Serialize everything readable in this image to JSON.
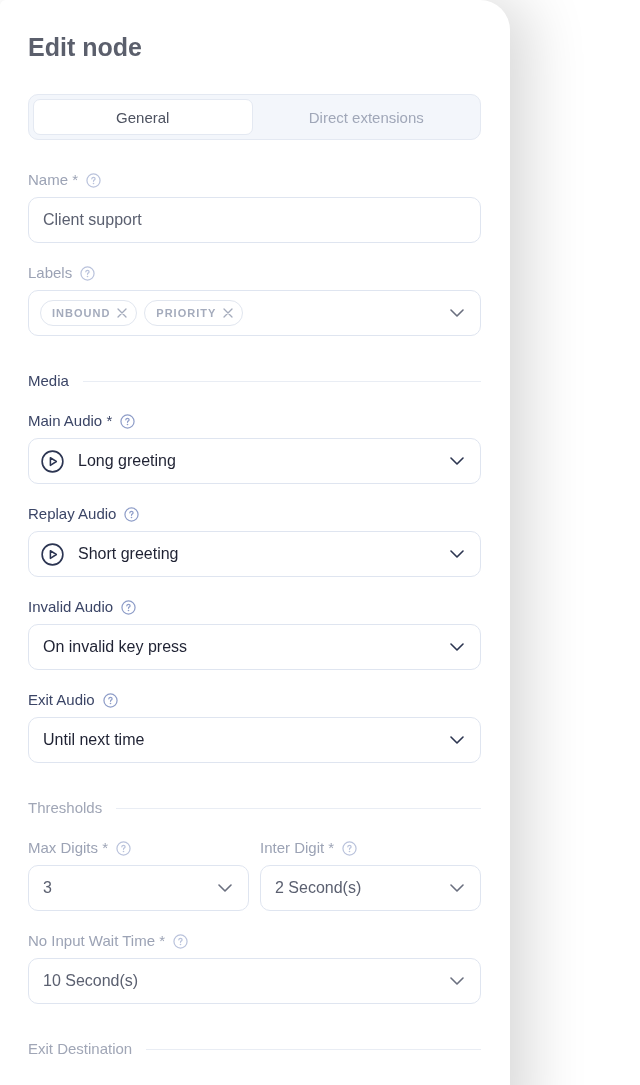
{
  "panel": {
    "title": "Edit node"
  },
  "tabs": [
    {
      "label": "General",
      "selected": true
    },
    {
      "label": "Direct extensions",
      "selected": false
    }
  ],
  "form": [
    {
      "kind": "text",
      "label": "Name *",
      "value": "Client support",
      "dimmed": true
    },
    {
      "kind": "tags",
      "label": "Labels",
      "tags": [
        "INBOUND",
        "PRIORITY"
      ],
      "dimmed": true
    },
    {
      "kind": "section",
      "title": "Media",
      "dimmed": false
    },
    {
      "kind": "audio_select",
      "label": "Main Audio *",
      "value": "Long greeting",
      "dimmed": false
    },
    {
      "kind": "audio_select",
      "label": "Replay Audio",
      "value": "Short greeting",
      "dimmed": false
    },
    {
      "kind": "select",
      "label": "Invalid Audio",
      "value": "On invalid key press",
      "dimmed": false
    },
    {
      "kind": "select",
      "label": "Exit Audio",
      "value": "Until next time",
      "dimmed": false
    },
    {
      "kind": "section",
      "title": "Thresholds",
      "dimmed": true
    },
    {
      "kind": "pair",
      "fields": [
        {
          "kind": "select",
          "label": "Max Digits *",
          "value": "3",
          "dimmed": true
        },
        {
          "kind": "select",
          "label": "Inter Digit *",
          "value": "2 Second(s)",
          "dimmed": true
        }
      ]
    },
    {
      "kind": "select",
      "label": "No Input Wait Time *",
      "value": "10 Second(s)",
      "dimmed": true
    },
    {
      "kind": "section",
      "title": "Exit Destination",
      "dimmed": true
    }
  ]
}
